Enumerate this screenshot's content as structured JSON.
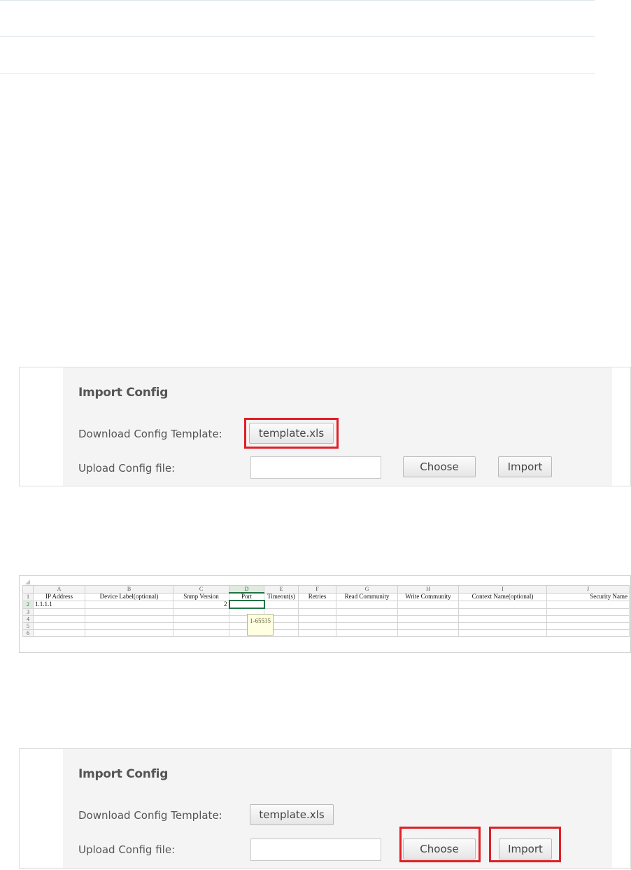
{
  "panel_top": {
    "title": "Import Config",
    "download_label": "Download Config Template:",
    "template_button": "template.xls",
    "upload_label": "Upload Config file:",
    "file_value": "",
    "choose_button": "Choose",
    "import_button": "Import",
    "highlight_color": "#e01f26"
  },
  "spreadsheet": {
    "column_letters": [
      "A",
      "B",
      "C",
      "D",
      "E",
      "F",
      "G",
      "H",
      "I",
      "J"
    ],
    "row_numbers": [
      "1",
      "2",
      "3",
      "4",
      "5",
      "6"
    ],
    "headers": [
      "IP Address",
      "Device Label(optional)",
      "Snmp Version",
      "Port",
      "Timeout(s)",
      "Retries",
      "Read Community",
      "Write Community",
      "Context Name(optional)",
      "Security Name"
    ],
    "row2": {
      "ip_address": "1.1.1.1",
      "snmp_version": "2"
    },
    "tooltip": "1-65535",
    "accent_color": "#217346"
  },
  "panel_bottom": {
    "title": "Import Config",
    "download_label": "Download Config Template:",
    "template_button": "template.xls",
    "upload_label": "Upload Config file:",
    "file_value": "",
    "choose_button": "Choose",
    "import_button": "Import"
  }
}
